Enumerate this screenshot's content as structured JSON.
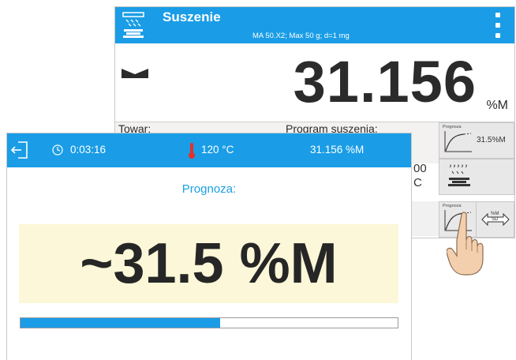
{
  "main": {
    "title": "Suszenie",
    "subtitle": "MA 50.X2; Max 50 g; d=1 mg",
    "reading": {
      "value": "31.156",
      "unit": "%M"
    },
    "info": {
      "product_label": "Towar:",
      "program_label": "Program suszenia:",
      "fragment_a": "00",
      "fragment_b": "C"
    },
    "tiles": {
      "forecast_top": {
        "caption": "Prognoza",
        "value": "31.5%M"
      },
      "forecast_bottom": {
        "caption": "Prognoza"
      },
      "swap_text_top": "%M",
      "swap_text_bottom": "SD"
    }
  },
  "popup": {
    "header": {
      "time": "0:03:16",
      "temperature": "120 °C",
      "value": "31.156 %M"
    },
    "title": "Prognoza:",
    "forecast": "~31.5 %M",
    "progress_fraction": 0.53
  },
  "icons": {
    "app": "drying-icon",
    "menu": "kebab-menu-icon",
    "stable": "stability-marker-icon",
    "exit": "exit-icon",
    "clock": "clock-icon",
    "temperature": "thermometer-icon",
    "pointer": "hand-pointer-icon"
  },
  "colors": {
    "accent": "#1a9de6",
    "forecast_bg": "#fbf7d8",
    "thermometer": "#e2312a"
  }
}
